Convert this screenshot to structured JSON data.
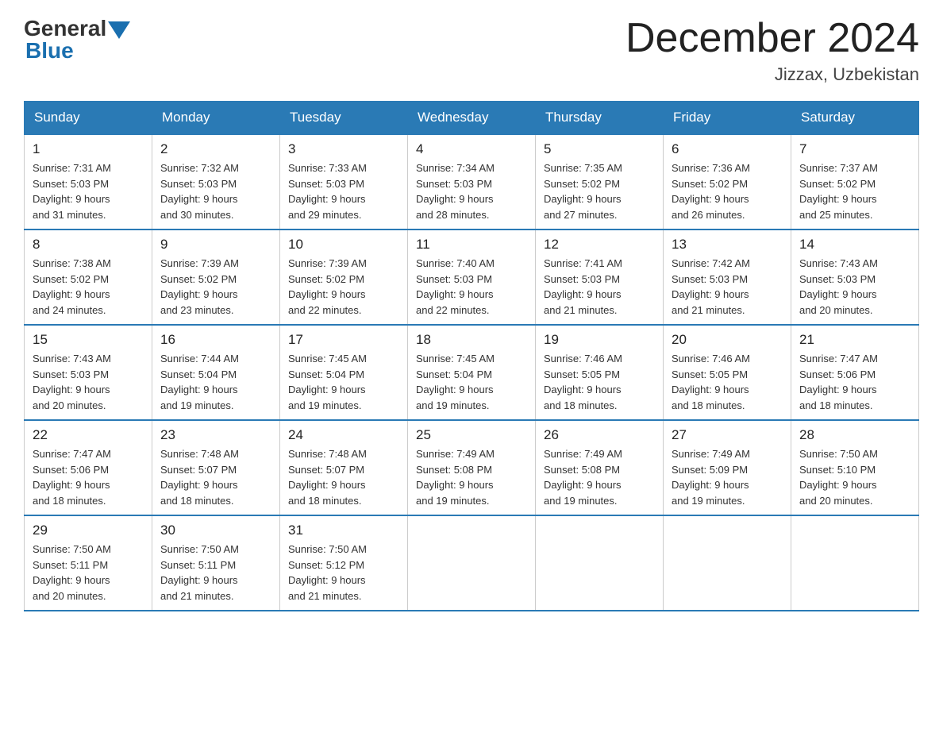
{
  "logo": {
    "general": "General",
    "blue": "Blue"
  },
  "header": {
    "title": "December 2024",
    "location": "Jizzax, Uzbekistan"
  },
  "weekdays": [
    "Sunday",
    "Monday",
    "Tuesday",
    "Wednesday",
    "Thursday",
    "Friday",
    "Saturday"
  ],
  "weeks": [
    [
      {
        "day": "1",
        "sunrise": "7:31 AM",
        "sunset": "5:03 PM",
        "daylight": "9 hours and 31 minutes."
      },
      {
        "day": "2",
        "sunrise": "7:32 AM",
        "sunset": "5:03 PM",
        "daylight": "9 hours and 30 minutes."
      },
      {
        "day": "3",
        "sunrise": "7:33 AM",
        "sunset": "5:03 PM",
        "daylight": "9 hours and 29 minutes."
      },
      {
        "day": "4",
        "sunrise": "7:34 AM",
        "sunset": "5:03 PM",
        "daylight": "9 hours and 28 minutes."
      },
      {
        "day": "5",
        "sunrise": "7:35 AM",
        "sunset": "5:02 PM",
        "daylight": "9 hours and 27 minutes."
      },
      {
        "day": "6",
        "sunrise": "7:36 AM",
        "sunset": "5:02 PM",
        "daylight": "9 hours and 26 minutes."
      },
      {
        "day": "7",
        "sunrise": "7:37 AM",
        "sunset": "5:02 PM",
        "daylight": "9 hours and 25 minutes."
      }
    ],
    [
      {
        "day": "8",
        "sunrise": "7:38 AM",
        "sunset": "5:02 PM",
        "daylight": "9 hours and 24 minutes."
      },
      {
        "day": "9",
        "sunrise": "7:39 AM",
        "sunset": "5:02 PM",
        "daylight": "9 hours and 23 minutes."
      },
      {
        "day": "10",
        "sunrise": "7:39 AM",
        "sunset": "5:02 PM",
        "daylight": "9 hours and 22 minutes."
      },
      {
        "day": "11",
        "sunrise": "7:40 AM",
        "sunset": "5:03 PM",
        "daylight": "9 hours and 22 minutes."
      },
      {
        "day": "12",
        "sunrise": "7:41 AM",
        "sunset": "5:03 PM",
        "daylight": "9 hours and 21 minutes."
      },
      {
        "day": "13",
        "sunrise": "7:42 AM",
        "sunset": "5:03 PM",
        "daylight": "9 hours and 21 minutes."
      },
      {
        "day": "14",
        "sunrise": "7:43 AM",
        "sunset": "5:03 PM",
        "daylight": "9 hours and 20 minutes."
      }
    ],
    [
      {
        "day": "15",
        "sunrise": "7:43 AM",
        "sunset": "5:03 PM",
        "daylight": "9 hours and 20 minutes."
      },
      {
        "day": "16",
        "sunrise": "7:44 AM",
        "sunset": "5:04 PM",
        "daylight": "9 hours and 19 minutes."
      },
      {
        "day": "17",
        "sunrise": "7:45 AM",
        "sunset": "5:04 PM",
        "daylight": "9 hours and 19 minutes."
      },
      {
        "day": "18",
        "sunrise": "7:45 AM",
        "sunset": "5:04 PM",
        "daylight": "9 hours and 19 minutes."
      },
      {
        "day": "19",
        "sunrise": "7:46 AM",
        "sunset": "5:05 PM",
        "daylight": "9 hours and 18 minutes."
      },
      {
        "day": "20",
        "sunrise": "7:46 AM",
        "sunset": "5:05 PM",
        "daylight": "9 hours and 18 minutes."
      },
      {
        "day": "21",
        "sunrise": "7:47 AM",
        "sunset": "5:06 PM",
        "daylight": "9 hours and 18 minutes."
      }
    ],
    [
      {
        "day": "22",
        "sunrise": "7:47 AM",
        "sunset": "5:06 PM",
        "daylight": "9 hours and 18 minutes."
      },
      {
        "day": "23",
        "sunrise": "7:48 AM",
        "sunset": "5:07 PM",
        "daylight": "9 hours and 18 minutes."
      },
      {
        "day": "24",
        "sunrise": "7:48 AM",
        "sunset": "5:07 PM",
        "daylight": "9 hours and 18 minutes."
      },
      {
        "day": "25",
        "sunrise": "7:49 AM",
        "sunset": "5:08 PM",
        "daylight": "9 hours and 19 minutes."
      },
      {
        "day": "26",
        "sunrise": "7:49 AM",
        "sunset": "5:08 PM",
        "daylight": "9 hours and 19 minutes."
      },
      {
        "day": "27",
        "sunrise": "7:49 AM",
        "sunset": "5:09 PM",
        "daylight": "9 hours and 19 minutes."
      },
      {
        "day": "28",
        "sunrise": "7:50 AM",
        "sunset": "5:10 PM",
        "daylight": "9 hours and 20 minutes."
      }
    ],
    [
      {
        "day": "29",
        "sunrise": "7:50 AM",
        "sunset": "5:11 PM",
        "daylight": "9 hours and 20 minutes."
      },
      {
        "day": "30",
        "sunrise": "7:50 AM",
        "sunset": "5:11 PM",
        "daylight": "9 hours and 21 minutes."
      },
      {
        "day": "31",
        "sunrise": "7:50 AM",
        "sunset": "5:12 PM",
        "daylight": "9 hours and 21 minutes."
      },
      null,
      null,
      null,
      null
    ]
  ],
  "labels": {
    "sunrise": "Sunrise:",
    "sunset": "Sunset:",
    "daylight": "Daylight:"
  }
}
